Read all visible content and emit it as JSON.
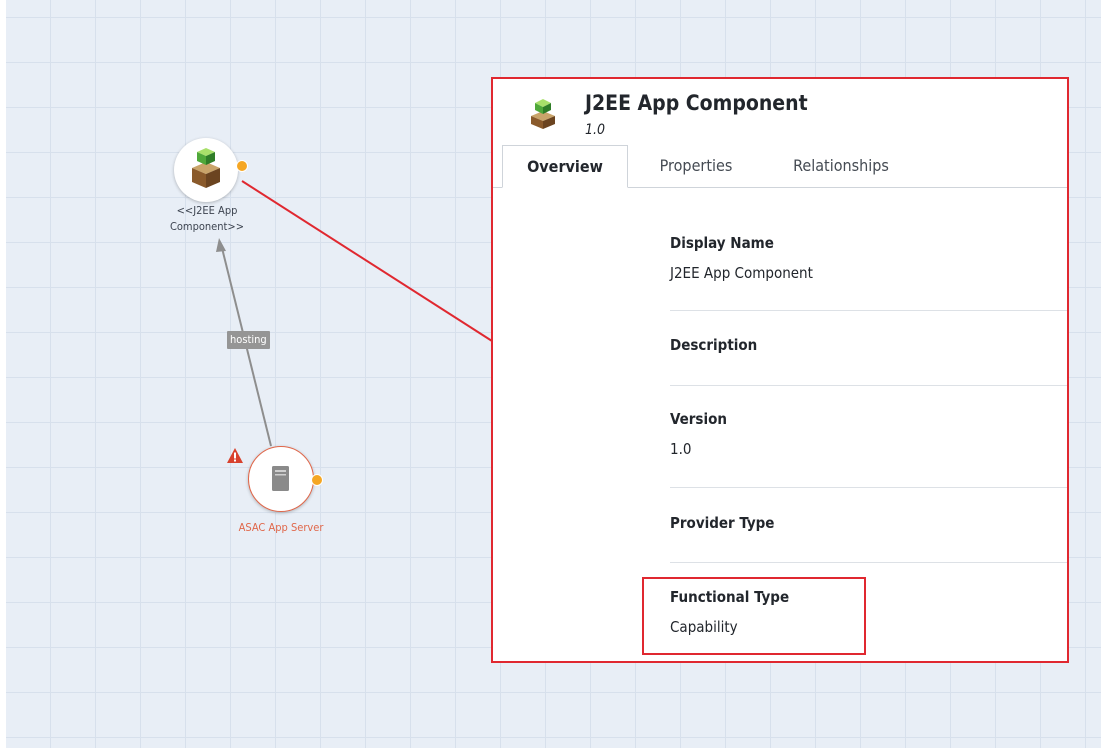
{
  "canvas": {
    "edge_label": "hosting",
    "nodes": [
      {
        "label_line1": "<<J2EE App",
        "label_line2": "Component>>",
        "icon": "package-icon"
      },
      {
        "label": "ASAC App Server",
        "icon": "server-icon",
        "status": "warning-icon"
      }
    ]
  },
  "panel": {
    "title": "J2EE App Component",
    "version": "1.0",
    "icon": "package-icon",
    "tabs": [
      {
        "label": "Overview",
        "active": true
      },
      {
        "label": "Properties",
        "active": false
      },
      {
        "label": "Relationships",
        "active": false
      }
    ],
    "fields": [
      {
        "label": "Display Name",
        "value": "J2EE App Component"
      },
      {
        "label": "Description",
        "value": ""
      },
      {
        "label": "Version",
        "value": "1.0"
      },
      {
        "label": "Provider Type",
        "value": ""
      },
      {
        "label": "Functional Type",
        "value": "Capability"
      }
    ]
  },
  "colors": {
    "highlight": "#e02830",
    "node_status": "#f5a623",
    "error_text": "#e0674a",
    "canvas_bg": "#e8eef6"
  }
}
